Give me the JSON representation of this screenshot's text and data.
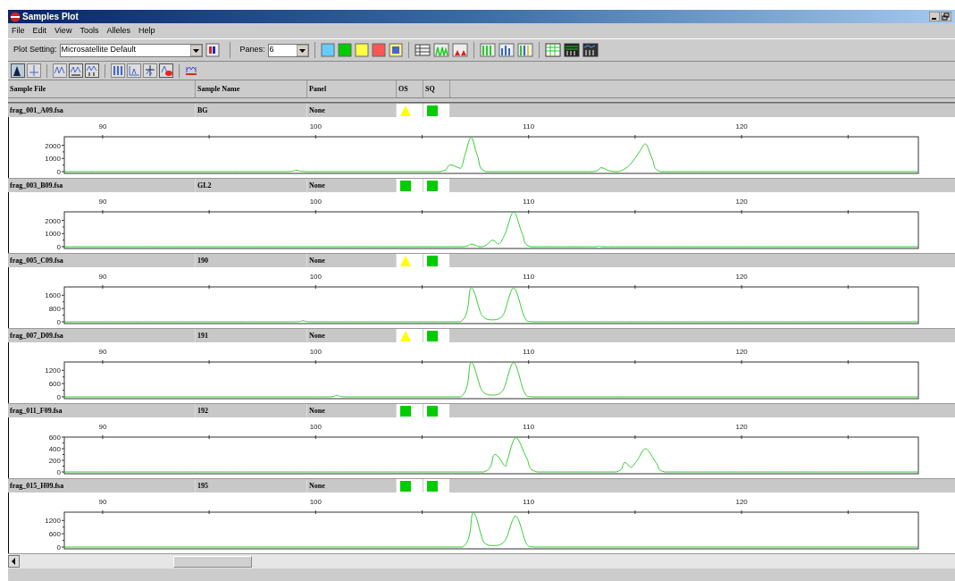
{
  "window": {
    "title": "Samples Plot"
  },
  "menu": [
    "File",
    "Edit",
    "View",
    "Tools",
    "Alleles",
    "Help"
  ],
  "toolbar": {
    "plot_setting_label": "Plot Setting:",
    "plot_setting_value": "Microsatellite Default",
    "panes_label": "Panes:",
    "panes_value": "6"
  },
  "columns": [
    "Sample File",
    "Sample Name",
    "Panel",
    "OS",
    "SQ"
  ],
  "samples": [
    {
      "file": "frag_001_A09.fsa",
      "name": "BG",
      "panel": "None",
      "os": {
        "kind": "warning"
      },
      "sq": {
        "kind": "pass"
      },
      "chart_data": {
        "type": "line",
        "x": [
          88.2,
          98.6,
          99.1,
          99.6,
          105.8,
          106.3,
          106.8,
          107.0,
          107.3,
          107.6,
          108.0,
          113.0,
          113.4,
          113.8,
          114.2,
          114.5,
          114.8,
          115.2,
          115.5,
          115.8,
          116.2,
          128.3
        ],
        "series": [
          {
            "color": "#33cc33",
            "values": [
              0,
              0,
              100,
              0,
              0,
              500,
              250,
              1200,
              2600,
              1200,
              0,
              0,
              300,
              50,
              0,
              200,
              600,
              1500,
              2100,
              1000,
              0,
              0
            ]
          }
        ],
        "xlim": [
          88.2,
          128.3
        ],
        "ylim": [
          0,
          2650
        ],
        "xticks": [
          90,
          100,
          110,
          120
        ],
        "yticks": [
          0,
          1000,
          2000
        ]
      }
    },
    {
      "file": "frag_003_B09.fsa",
      "name": "GL2",
      "panel": "None",
      "os": {
        "kind": "pass"
      },
      "sq": {
        "kind": "pass"
      },
      "chart_data": {
        "type": "line",
        "x": [
          88.2,
          106.9,
          107.3,
          107.7,
          108.0,
          108.3,
          108.6,
          108.9,
          109.3,
          109.7,
          110.1,
          113.1,
          113.3,
          113.5,
          128.3
        ],
        "series": [
          {
            "color": "#33cc33",
            "values": [
              0,
              0,
              200,
              0,
              100,
              500,
              200,
              1000,
              2650,
              1000,
              0,
              0,
              50,
              0,
              0
            ]
          }
        ],
        "xlim": [
          88.2,
          128.3
        ],
        "ylim": [
          0,
          2650
        ],
        "xticks": [
          90,
          100,
          110,
          120
        ],
        "yticks": [
          0,
          1000,
          2000
        ]
      }
    },
    {
      "file": "frag_005_C09.fsa",
      "name": "190",
      "panel": "None",
      "os": {
        "kind": "warning"
      },
      "sq": {
        "kind": "pass"
      },
      "chart_data": {
        "type": "line",
        "x": [
          88.2,
          99.0,
          99.4,
          99.8,
          106.8,
          107.3,
          107.8,
          108.3,
          108.8,
          109.3,
          109.8,
          110.2,
          128.3
        ],
        "series": [
          {
            "color": "#33cc33",
            "values": [
              0,
              0,
              60,
              0,
              0,
              2050,
              400,
              120,
              400,
              2050,
              300,
              0,
              0
            ]
          }
        ],
        "xlim": [
          88.2,
          128.3
        ],
        "ylim": [
          0,
          2100
        ],
        "xticks": [
          90,
          100,
          110,
          120
        ],
        "yticks": [
          0,
          800,
          1600
        ]
      }
    },
    {
      "file": "frag_007_D09.fsa",
      "name": "191",
      "panel": "None",
      "os": {
        "kind": "warning"
      },
      "sq": {
        "kind": "pass"
      },
      "chart_data": {
        "type": "line",
        "x": [
          88.2,
          100.6,
          101.0,
          101.4,
          106.8,
          107.3,
          107.8,
          108.3,
          108.8,
          109.3,
          109.8,
          110.2,
          128.3
        ],
        "series": [
          {
            "color": "#33cc33",
            "values": [
              0,
              0,
              70,
              0,
              0,
              1550,
              300,
              80,
              300,
              1550,
              200,
              0,
              0
            ]
          }
        ],
        "xlim": [
          88.2,
          128.3
        ],
        "ylim": [
          0,
          1575
        ],
        "xticks": [
          90,
          100,
          110,
          120
        ],
        "yticks": [
          0,
          600,
          1200
        ]
      }
    },
    {
      "file": "frag_011_F09.fsa",
      "name": "192",
      "panel": "None",
      "os": {
        "kind": "pass"
      },
      "sq": {
        "kind": "pass"
      },
      "chart_data": {
        "type": "line",
        "x": [
          88.2,
          107.9,
          108.4,
          108.9,
          109.0,
          109.4,
          109.9,
          110.4,
          114.1,
          114.5,
          114.8,
          115.1,
          115.5,
          116.0,
          116.4,
          128.3
        ],
        "series": [
          {
            "color": "#33cc33",
            "values": [
              0,
              0,
              300,
              100,
              200,
              590,
              250,
              0,
              0,
              160,
              80,
              200,
              400,
              150,
              0,
              0
            ]
          }
        ],
        "xlim": [
          88.2,
          128.3
        ],
        "ylim": [
          0,
          600
        ],
        "xticks": [
          90,
          100,
          110,
          120
        ],
        "yticks": [
          0,
          200,
          400,
          600
        ]
      }
    },
    {
      "file": "frag_015_H09.fsa",
      "name": "195",
      "panel": "None",
      "os": {
        "kind": "pass"
      },
      "sq": {
        "kind": "pass"
      },
      "chart_data": {
        "type": "line",
        "x": [
          88.2,
          106.9,
          107.4,
          107.9,
          108.4,
          108.9,
          109.4,
          109.9,
          110.3,
          128.3
        ],
        "series": [
          {
            "color": "#33cc33",
            "values": [
              0,
              0,
              1550,
              200,
              60,
              300,
              1400,
              150,
              0,
              0
            ]
          }
        ],
        "xlim": [
          88.2,
          128.3
        ],
        "ylim": [
          0,
          1575
        ],
        "xticks": [
          90,
          100,
          110,
          120
        ],
        "yticks": [
          0,
          600,
          1200
        ]
      }
    }
  ]
}
